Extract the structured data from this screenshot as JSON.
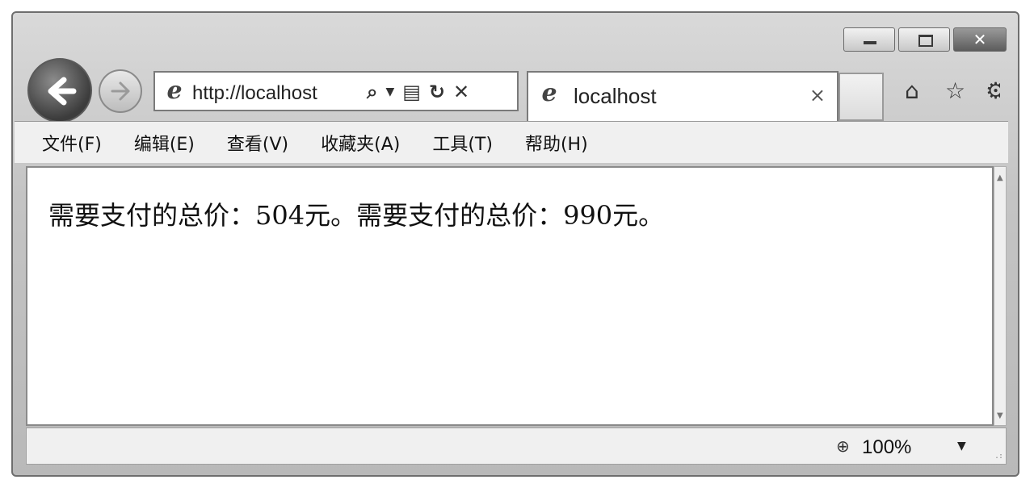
{
  "window": {
    "minimize_label": "",
    "maximize_label": "",
    "close_label": "✕"
  },
  "nav": {
    "address_text": "http://localhost"
  },
  "tab": {
    "title": "localhost",
    "close_glyph": "×"
  },
  "menu": {
    "items": [
      "文件(F)",
      "编辑(E)",
      "查看(V)",
      "收藏夹(A)",
      "工具(T)",
      "帮助(H)"
    ]
  },
  "content": {
    "text": "需要支付的总价：504元。需要支付的总价：990元。"
  },
  "status": {
    "zoom": "100%"
  },
  "icons": {
    "back": "back-arrow-icon",
    "forward": "forward-arrow-icon",
    "search": "search-icon",
    "compat": "compatibility-icon",
    "refresh": "refresh-icon",
    "stop": "stop-icon",
    "home": "home-icon",
    "favorites": "star-icon",
    "tools": "gear-icon",
    "zoom": "zoom-icon"
  }
}
